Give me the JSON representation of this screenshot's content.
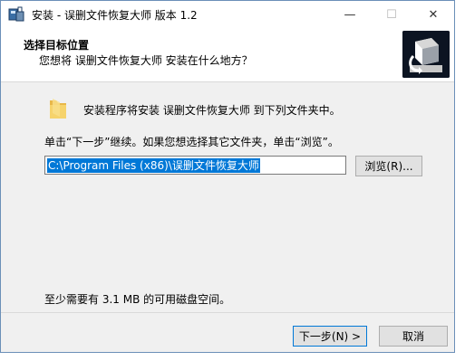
{
  "window": {
    "title": "安装 - 误删文件恢复大师 版本 1.2",
    "minimize_glyph": "—",
    "maximize_glyph": "☐",
    "close_glyph": "✕"
  },
  "header": {
    "title": "选择目标位置",
    "subtitle": "您想将 误删文件恢复大师 安装在什么地方？"
  },
  "content": {
    "intro": "安装程序将安装 误删文件恢复大师 到下列文件夹中。",
    "hint": "单击“下一步”继续。如果您想选择其它文件夹，单击“浏览”。",
    "path_value": "C:\\Program Files (x86)\\误删文件恢复大师",
    "browse_label": "浏览(R)...",
    "space_required": "至少需要有 3.1 MB 的可用磁盘空间。"
  },
  "footer": {
    "next_label": "下一步(N) >",
    "cancel_label": "取消"
  },
  "colors": {
    "selection": "#0078d7",
    "logo_bg": "#0c1422"
  }
}
